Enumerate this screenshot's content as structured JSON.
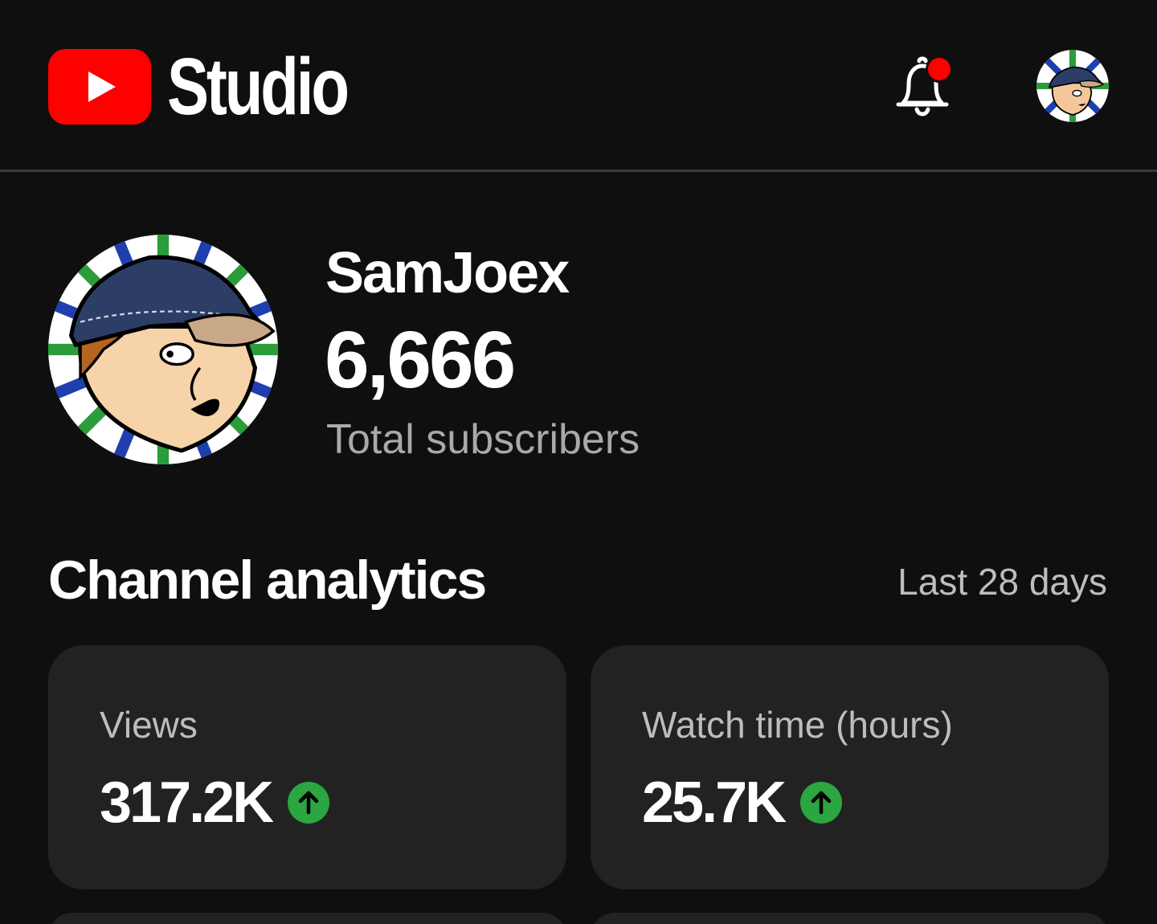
{
  "header": {
    "logo_text": "Studio",
    "icons": {
      "logo": "youtube-play-icon",
      "notifications": "bell-icon",
      "account": "avatar"
    },
    "has_unread_notification": true
  },
  "channel": {
    "name": "SamJoex",
    "subscriber_count": "6,666",
    "subscriber_label": "Total subscribers"
  },
  "analytics": {
    "title": "Channel analytics",
    "range": "Last 28 days",
    "cards": [
      {
        "label": "Views",
        "value": "317.2K",
        "trend": "up"
      },
      {
        "label": "Watch time (hours)",
        "value": "25.7K",
        "trend": "up"
      }
    ]
  },
  "colors": {
    "background": "#0f0f0f",
    "card": "#222222",
    "brand_red": "#ff0000",
    "trend_up": "#2ba640",
    "notification_dot": "#ff0000"
  }
}
